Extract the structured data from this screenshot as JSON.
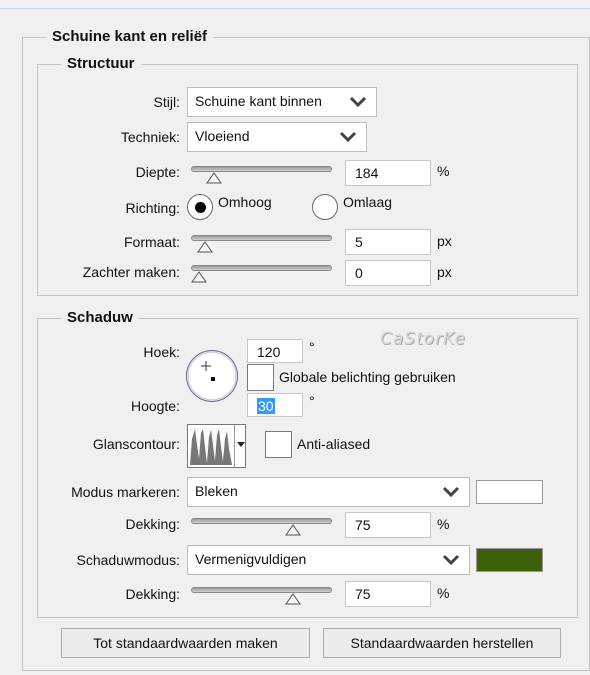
{
  "groups": {
    "bevel_title": "Schuine kant en reliëf",
    "structure_title": "Structuur",
    "shading_title": "Schaduw"
  },
  "structure": {
    "style_label": "Stijl:",
    "style_value": "Schuine kant binnen",
    "technique_label": "Techniek:",
    "technique_value": "Vloeiend",
    "depth_label": "Diepte:",
    "depth_value": "184",
    "depth_unit": "%",
    "depth_slider_fraction": 0.12,
    "direction_label": "Richting:",
    "direction_up": "Omhoog",
    "direction_down": "Omlaag",
    "direction_selected": "Omhoog",
    "size_label": "Formaat:",
    "size_value": "5",
    "size_unit": "px",
    "size_slider_fraction": 0.05,
    "soften_label": "Zachter maken:",
    "soften_value": "0",
    "soften_unit": "px",
    "soften_slider_fraction": 0.0
  },
  "shading": {
    "angle_label": "Hoek:",
    "angle_value": "120",
    "angle_unit": "°",
    "global_light_label": "Globale belichting gebruiken",
    "global_light_checked": false,
    "altitude_label": "Hoogte:",
    "altitude_value": "30",
    "altitude_unit": "°",
    "gloss_contour_label": "Glanscontour:",
    "anti_aliased_label": "Anti-aliased",
    "anti_aliased_checked": false,
    "highlight_mode_label": "Modus markeren:",
    "highlight_mode_value": "Bleken",
    "highlight_color": "#ffffff",
    "highlight_opacity_label": "Dekking:",
    "highlight_opacity_value": "75",
    "highlight_opacity_unit": "%",
    "highlight_opacity_fraction": 0.75,
    "shadow_mode_label": "Schaduwmodus:",
    "shadow_mode_value": "Vermenigvuldigen",
    "shadow_color": "#3c6109",
    "shadow_opacity_label": "Dekking:",
    "shadow_opacity_value": "75",
    "shadow_opacity_unit": "%",
    "shadow_opacity_fraction": 0.75
  },
  "watermark": "CaStorKe",
  "buttons": {
    "make_default": "Tot standaardwaarden maken",
    "reset_default": "Standaardwaarden herstellen"
  },
  "icons": {
    "chevron": "chevron-down-icon",
    "slider_thumb": "triangle-slider-thumb",
    "angle_crosshair": "crosshair-icon"
  }
}
